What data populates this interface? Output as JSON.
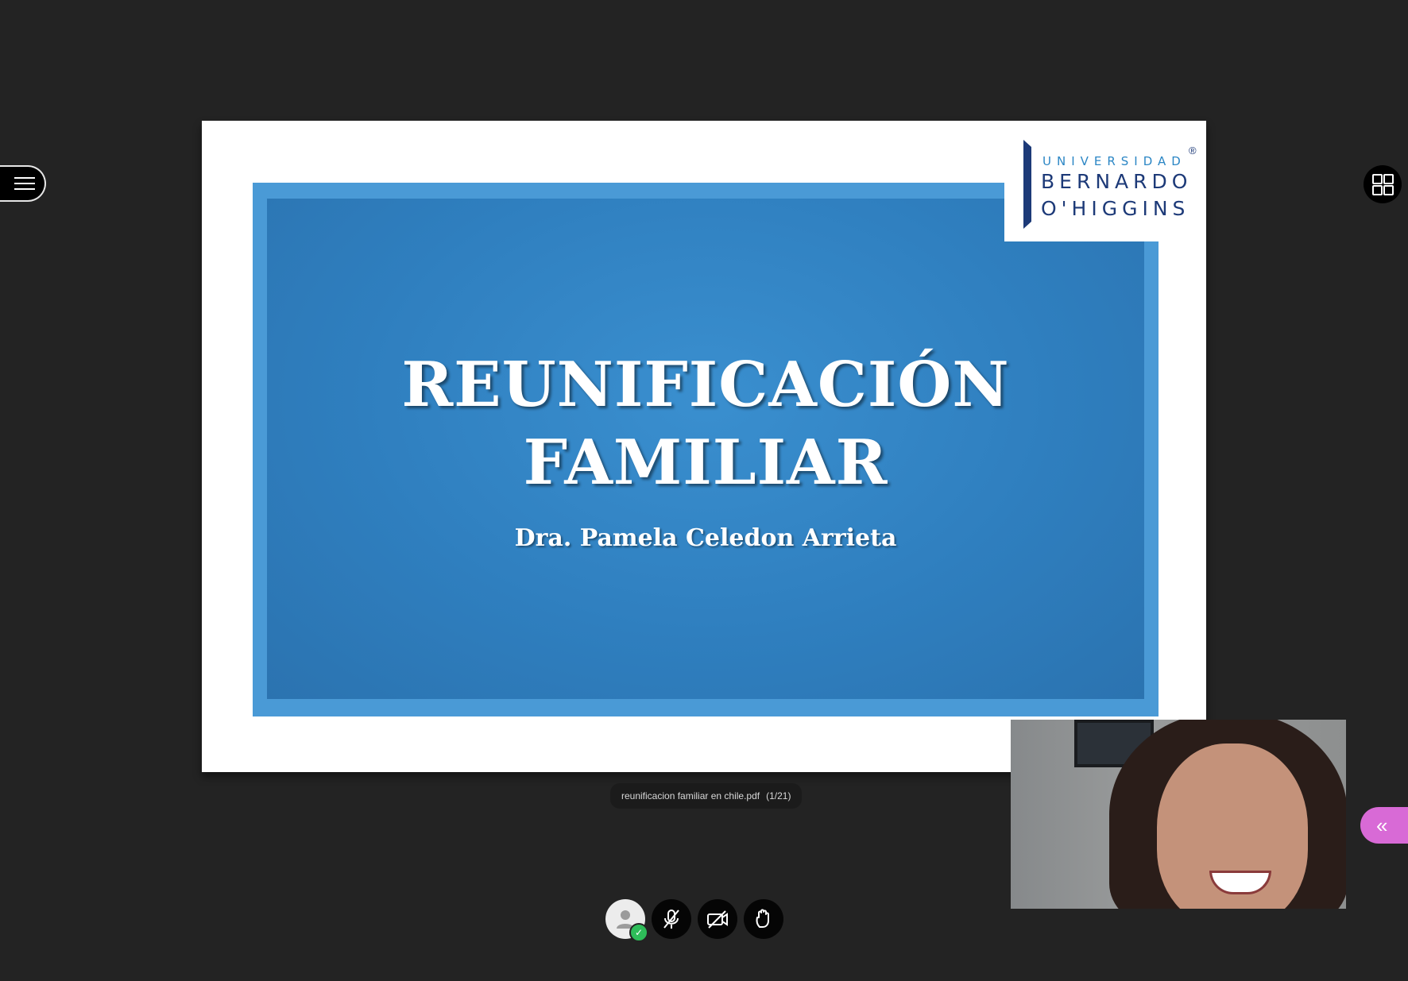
{
  "slide": {
    "title_line1": "REUNIFICACIÓN",
    "title_line2": "FAMILIAR",
    "subtitle": "Dra. Pamela Celedon Arrieta",
    "logo": {
      "line1": "UNIVERSIDAD",
      "line2": "BERNARDO",
      "line3": "O'HIGGINS",
      "registered": "®"
    }
  },
  "presentation": {
    "filename": "reunificacion familiar en chile.pdf",
    "page_indicator": "(1/21)"
  },
  "controls": {
    "panel_toggle_glyph": "«",
    "user_status_glyph": "✓"
  },
  "colors": {
    "background": "#232323",
    "slide_blue": "#2f7fbf",
    "slide_frame": "#4a9ad6",
    "panel_toggle": "#d86ad6",
    "joined_status": "#2ebd59"
  }
}
